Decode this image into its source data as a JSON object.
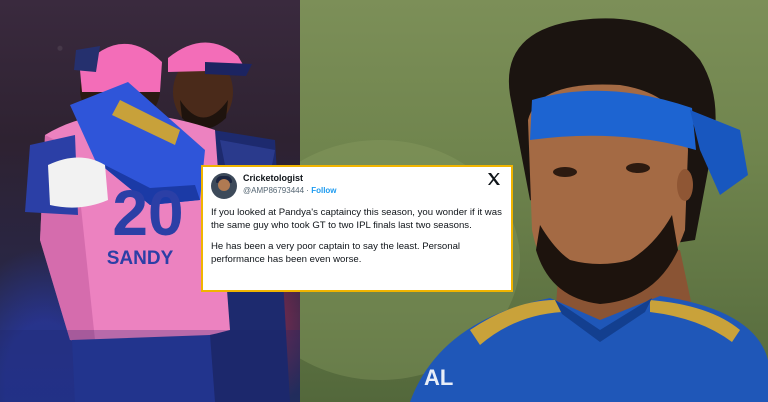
{
  "tweet": {
    "author_name": "Cricketologist",
    "author_handle": "@AMP86793444",
    "separator": "·",
    "follow_label": "Follow",
    "paragraph_1": "If you looked at Pandya's captaincy this season, you wonder if it was the same guy who took GT to two IPL finals last two seasons.",
    "paragraph_2": "He has been a very poor captain to say the least. Personal performance has been even worse."
  },
  "left_photo": {
    "jersey_name": "SANDY",
    "jersey_number": "20"
  },
  "right_photo": {
    "jersey_text": "AL"
  },
  "icons": [
    "x-logo-icon",
    "avatar"
  ],
  "colors": {
    "card_border": "#f0b400",
    "follow": "#1d9bf0",
    "rr_pink": "#ec82c0",
    "mi_blue": "#1f57b8"
  }
}
